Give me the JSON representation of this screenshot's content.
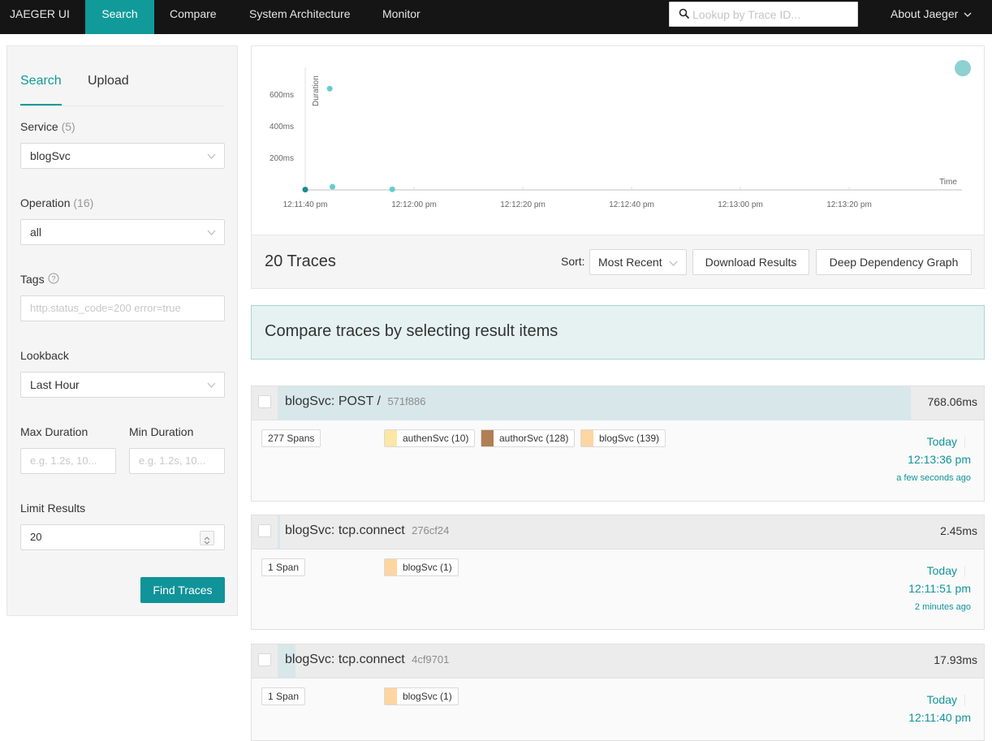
{
  "nav": {
    "brand": "JAEGER UI",
    "items": [
      "Search",
      "Compare",
      "System Architecture",
      "Monitor"
    ],
    "lookup_placeholder": "Lookup by Trace ID...",
    "about": "About Jaeger"
  },
  "sidebar": {
    "tabs": [
      "Search",
      "Upload"
    ],
    "service_label": "Service",
    "service_count": "(5)",
    "service_value": "blogSvc",
    "operation_label": "Operation",
    "operation_count": "(16)",
    "operation_value": "all",
    "tags_label": "Tags",
    "tags_placeholder": "http.status_code=200 error=true",
    "lookback_label": "Lookback",
    "lookback_value": "Last Hour",
    "max_duration_label": "Max Duration",
    "min_duration_label": "Min Duration",
    "duration_placeholder": "e.g. 1.2s, 10...",
    "limit_label": "Limit Results",
    "limit_value": "20",
    "find_button": "Find Traces"
  },
  "chart_data": {
    "type": "scatter",
    "ylabel": "Duration",
    "xlabel": "Time",
    "y_ticks": [
      "200ms",
      "400ms",
      "600ms"
    ],
    "x_ticks": [
      "12:11:40 pm",
      "12:12:00 pm",
      "12:12:20 pm",
      "12:12:40 pm",
      "12:13:00 pm",
      "12:13:20 pm"
    ],
    "ylim": [
      0,
      780
    ],
    "xlim_seconds_from_12_11_40": [
      0,
      120
    ],
    "points": [
      {
        "t": 0,
        "ms": 2
      },
      {
        "t": 4.5,
        "ms": 640
      },
      {
        "t": 5,
        "ms": 20
      },
      {
        "t": 16,
        "ms": 4
      }
    ],
    "point_color": "#66cccc"
  },
  "results": {
    "count": "20 Traces",
    "sort_label": "Sort:",
    "sort_value": "Most Recent",
    "download_button": "Download Results",
    "ddg_button": "Deep Dependency Graph"
  },
  "compare_banner": "Compare traces by selecting result items",
  "traces": [
    {
      "title": "blogSvc: POST /",
      "id": "571f886",
      "duration": "768.06ms",
      "spans": "277 Spans",
      "services": [
        {
          "name": "authenSvc (10)",
          "color": "#fde6a6"
        },
        {
          "name": "authorSvc (128)",
          "color": "#b07f54"
        },
        {
          "name": "blogSvc (139)",
          "color": "#fdd5a1"
        }
      ],
      "date": "Today",
      "time": "12:13:36 pm",
      "ago": "a few seconds ago"
    },
    {
      "title": "blogSvc: tcp.connect",
      "id": "276cf24",
      "duration": "2.45ms",
      "spans": "1 Span",
      "services": [
        {
          "name": "blogSvc (1)",
          "color": "#fdd5a1"
        }
      ],
      "date": "Today",
      "time": "12:11:51 pm",
      "ago": "2 minutes ago"
    },
    {
      "title": "blogSvc: tcp.connect",
      "id": "4cf9701",
      "duration": "17.93ms",
      "spans": "1 Span",
      "services": [
        {
          "name": "blogSvc (1)",
          "color": "#fdd5a1"
        }
      ],
      "date": "Today",
      "time": "12:11:40 pm",
      "ago": ""
    }
  ]
}
